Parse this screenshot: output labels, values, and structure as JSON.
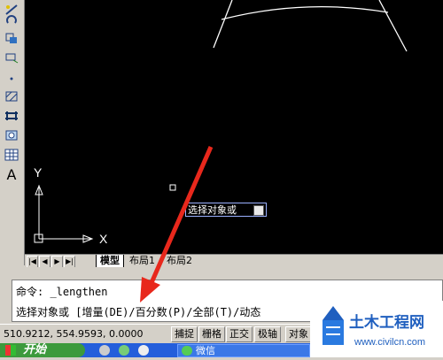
{
  "tooltip": {
    "text": "选择对象或"
  },
  "axis": {
    "x_label": "X",
    "y_label": "Y"
  },
  "tabs": {
    "model": "模型",
    "layout1": "布局1",
    "layout2": "布局2"
  },
  "command": {
    "line1": "命令: _lengthen",
    "line2": "选择对象或 [增量(DE)/百分数(P)/全部(T)/动态"
  },
  "status": {
    "coordinates": "510.9212, 554.9593, 0.0000",
    "buttons": [
      "捕捉",
      "栅格",
      "正交",
      "极轴",
      "对象"
    ]
  },
  "taskbar": {
    "start_label": "开始",
    "wechat_label": "微信"
  },
  "toolbar": {
    "text_tool_label": "A"
  },
  "watermark": {
    "title": "土木工程网",
    "url": "www.civilcn.com"
  },
  "colors": {
    "canvas": "#000000",
    "arrow": "#e8281c",
    "brand_blue": "#1f5fbf"
  }
}
